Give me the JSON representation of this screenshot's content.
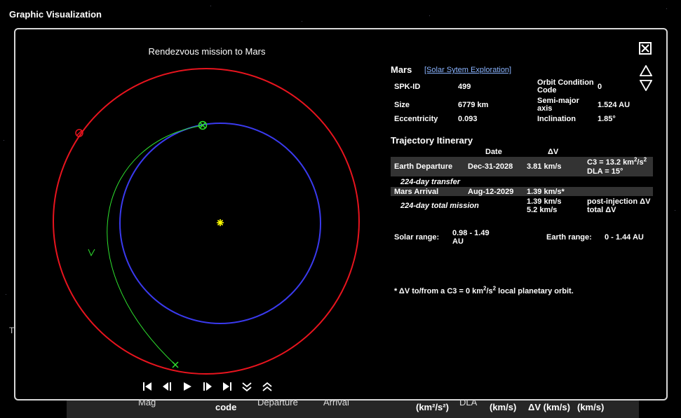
{
  "page": {
    "title": "Graphic Visualization",
    "left_fragment": "T"
  },
  "background_table": {
    "headers": [
      "Mag",
      "code",
      "Departure",
      "Arrival",
      "(km²/s²)",
      "DLA",
      "(km/s)",
      "ΔV (km/s)",
      "(km/s)"
    ]
  },
  "plot": {
    "title": "Rendezvous mission to Mars",
    "colors": {
      "mars_orbit": "#e8141e",
      "earth_orbit": "#3a3aee",
      "transfer": "#2ee22e",
      "sun": "#ffff00"
    }
  },
  "controls": {
    "items": [
      {
        "name": "first-frame",
        "icon": "skip-start-icon"
      },
      {
        "name": "step-back",
        "icon": "step-back-icon"
      },
      {
        "name": "play",
        "icon": "play-icon"
      },
      {
        "name": "step-forward",
        "icon": "step-forward-icon"
      },
      {
        "name": "last-frame",
        "icon": "skip-end-icon"
      },
      {
        "name": "slower",
        "icon": "double-chevron-down-icon"
      },
      {
        "name": "faster",
        "icon": "double-chevron-up-icon"
      }
    ]
  },
  "target": {
    "name": "Mars",
    "link": "[Solar Sytem Exploration]",
    "spk_label": "SPK-ID",
    "spk_value": "499",
    "size_label": "Size",
    "size_value": "6779 km",
    "ecc_label": "Eccentricity",
    "ecc_value": "0.093",
    "occ_label_1": "Orbit Condition",
    "occ_label_2": "Code",
    "occ_value": "0",
    "sma_label_1": "Semi-major",
    "sma_label_2": "axis",
    "sma_value": "1.524 AU",
    "inc_label": "Inclination",
    "inc_value": "1.85°"
  },
  "itinerary": {
    "title": "Trajectory Itinerary",
    "col_date": "Date",
    "col_dv": "ΔV",
    "departure": {
      "label": "Earth Departure",
      "date": "Dec-31-2028",
      "dv": "3.81 km/s",
      "c3_prefix": "C3 = 13.2 km",
      "c3_exp1": "2",
      "c3_mid": "/s",
      "c3_exp2": "2",
      "dla": "DLA = 15°"
    },
    "transfer": "224-day transfer",
    "arrival": {
      "label": "Mars Arrival",
      "date": "Aug-12-2029",
      "dv": "1.39 km/s*"
    },
    "total": {
      "label": "224-day total mission",
      "dv1": "1.39 km/s",
      "dv2": "5.2 km/s",
      "note1": "post-injection ΔV",
      "note2": "total ΔV"
    },
    "solar_range_label": "Solar range:",
    "solar_range_value_1": "0.98 - 1.49",
    "solar_range_value_2": "AU",
    "earth_range_label": "Earth range:",
    "earth_range_value": "0 - 1.44 AU",
    "footnote_1": "* ΔV to/from a C3 = 0 km",
    "footnote_exp1": "2",
    "footnote_2": "/s",
    "footnote_exp2": "2",
    "footnote_3": " local planetary orbit."
  }
}
